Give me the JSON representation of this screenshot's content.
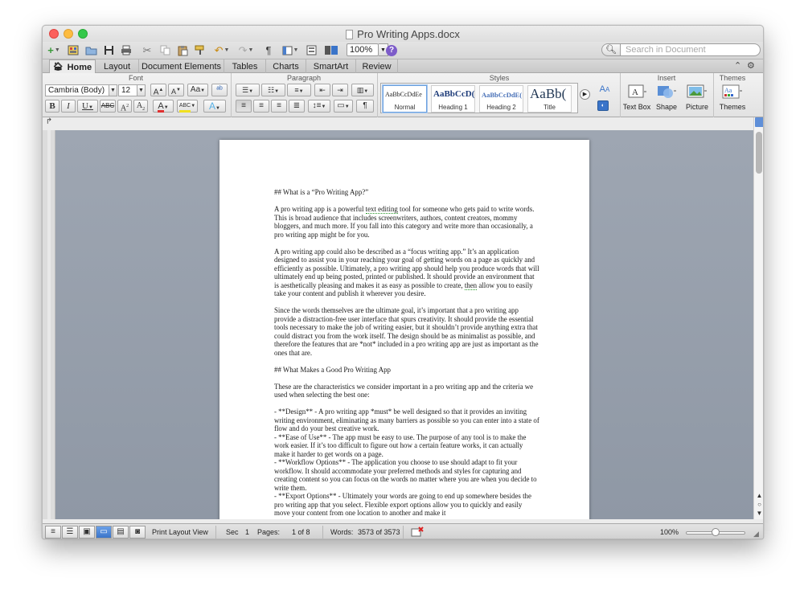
{
  "window": {
    "title": "Pro Writing Apps.docx"
  },
  "toolbar": {
    "zoom": "100%",
    "search_placeholder": "Search in Document"
  },
  "tabs": [
    {
      "label": "Home"
    },
    {
      "label": "Layout"
    },
    {
      "label": "Document Elements"
    },
    {
      "label": "Tables"
    },
    {
      "label": "Charts"
    },
    {
      "label": "SmartArt"
    },
    {
      "label": "Review"
    }
  ],
  "ribbon": {
    "font_group": "Font",
    "paragraph_group": "Paragraph",
    "styles_group": "Styles",
    "insert_group": "Insert",
    "themes_group": "Themes",
    "font_name": "Cambria (Body)",
    "font_size": "12",
    "styles": [
      {
        "sample": "AaBbCcDdEe",
        "name": "Normal"
      },
      {
        "sample": "AaBbCcD(",
        "name": "Heading 1"
      },
      {
        "sample": "AaBbCcDdE(",
        "name": "Heading 2"
      },
      {
        "sample": "AaBb(",
        "name": "Title"
      }
    ],
    "insert_items": [
      {
        "label": "Text Box"
      },
      {
        "label": "Shape"
      },
      {
        "label": "Picture"
      }
    ],
    "themes_label": "Themes"
  },
  "document": {
    "p1": "## What is a “Pro Writing App?”",
    "p2a": "A pro writing app is a powerful ",
    "p2_flag": "text editing",
    "p2b": " tool for someone who gets paid to write words. This is broad audience that includes screenwriters, authors, content creators, mommy bloggers, and much more. If you fall into this category and write more than occasionally, a pro writing app might be for you.",
    "p3a": "A pro writing app could also be described as a “focus writing app.” It’s an application designed to assist you in your reaching your goal of getting words on a page as quickly and efficiently as possible. Ultimately, a pro writing app should help you produce words that will ultimately end up being posted, printed or published. It should provide an environment that is aesthetically pleasing and makes it as easy as possible to create, ",
    "p3_flag": "then",
    "p3b": " allow you to easily take your content and publish it wherever you desire.",
    "p4": "Since the words themselves are the ultimate goal, it’s important that a pro writing app provide a distraction-free user interface that spurs creativity. It should provide the essential tools necessary to make the job of writing easier, but it shouldn’t provide anything extra that could distract you from the work itself. The design should be as minimalist as possible, and therefore the features that are *not* included in a pro writing app are just as important as the ones that are.",
    "p5": "## What Makes a Good Pro Writing App",
    "p6": "These are the characteristics we consider important in a pro writing app and the criteria we used when selecting the best one:",
    "p7": "- **Design** - A pro writing app *must* be well designed so that it provides an inviting writing environment, eliminating as many barriers as possible so you can enter into a state of flow and do your best creative work.",
    "p8": "- **Ease of Use** - The app must be easy to use. The purpose of any tool is to make the work easier. If it’s too difficult to figure out how a certain feature works, it can actually make it harder to get words on a page.",
    "p9": "- **Workflow Options** - The application you choose to use should adapt to fit your workflow. It should accommodate your preferred methods and styles for capturing and creating content so you can focus on the words no matter where you are when you decide to write them.",
    "p10": "- **Export Options** - Ultimately your words are going to end up somewhere besides the pro writing app that you select. Flexible export options allow you to quickly and easily move your content from one location to another and make it"
  },
  "status": {
    "view": "Print Layout View",
    "sec_label": "Sec",
    "sec_value": "1",
    "pages_label": "Pages:",
    "pages_value": "1 of 8",
    "words_label": "Words:",
    "words_value": "3573 of 3573",
    "zoom": "100%"
  },
  "zoom_level": 0.5,
  "colors": {
    "accent": "#3a74c9",
    "page_bg": "#9ea6b2",
    "help": "#7d5cc9"
  }
}
